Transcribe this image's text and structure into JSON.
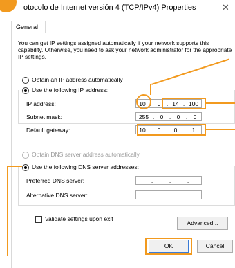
{
  "window": {
    "title": "otocolo de Internet versión 4 (TCP/IPv4) Properties",
    "close_glyph": "✕"
  },
  "tabs": [
    {
      "label": "General"
    }
  ],
  "description": "You can get IP settings assigned automatically if your network supports this capability. Otherwise, you need to ask your network administrator for the appropriate IP settings.",
  "ip_section": {
    "auto_label": "Obtain an IP address automatically",
    "manual_label": "Use the following IP address:",
    "selected": "manual",
    "fields": {
      "ip_address": {
        "label": "IP address:",
        "octets": [
          "10",
          "0",
          "14",
          "100"
        ]
      },
      "subnet_mask": {
        "label": "Subnet mask:",
        "octets": [
          "255",
          "0",
          "0",
          "0"
        ]
      },
      "default_gateway": {
        "label": "Default gateway:",
        "octets": [
          "10",
          "0",
          "0",
          "1"
        ]
      }
    }
  },
  "dns_section": {
    "auto_label": "Obtain DNS server address automatically",
    "manual_label": "Use the following DNS server addresses:",
    "selected": "manual",
    "fields": {
      "preferred": {
        "label": "Preferred DNS server:",
        "octets": [
          "",
          "",
          "",
          ""
        ]
      },
      "alternative": {
        "label": "Alternative DNS server:",
        "octets": [
          "",
          "",
          "",
          ""
        ]
      }
    }
  },
  "validate_checkbox": {
    "label": "Validate settings upon exit",
    "checked": false
  },
  "buttons": {
    "advanced": "Advanced...",
    "ok": "OK",
    "cancel": "Cancel"
  },
  "colors": {
    "highlight": "#f29a1f",
    "step_badge": "#f29a1f"
  },
  "icons": {
    "step_badge": "step-badge-icon",
    "close": "close-icon"
  }
}
